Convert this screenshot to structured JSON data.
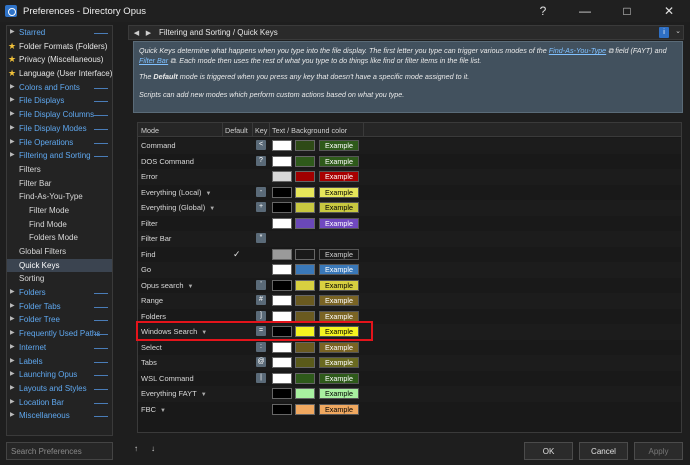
{
  "window": {
    "title": "Preferences - Directory Opus",
    "controls": [
      "?",
      "—",
      "□",
      "✕"
    ]
  },
  "sidebar": {
    "items": [
      {
        "label": "Starred",
        "level": "top"
      },
      {
        "label": "Folder Formats (Folders)",
        "level": "star"
      },
      {
        "label": "Privacy (Miscellaneous)",
        "level": "star"
      },
      {
        "label": "Language (User Interface)",
        "level": "star"
      },
      {
        "label": "Colors and Fonts",
        "level": "top"
      },
      {
        "label": "File Displays",
        "level": "top"
      },
      {
        "label": "File Display Columns",
        "level": "top"
      },
      {
        "label": "File Display Modes",
        "level": "top"
      },
      {
        "label": "File Operations",
        "level": "top"
      },
      {
        "label": "Filtering and Sorting",
        "level": "top"
      },
      {
        "label": "Filters",
        "level": "sub"
      },
      {
        "label": "Filter Bar",
        "level": "sub"
      },
      {
        "label": "Find-As-You-Type",
        "level": "sub"
      },
      {
        "label": "Filter Mode",
        "level": "subsub"
      },
      {
        "label": "Find Mode",
        "level": "subsub"
      },
      {
        "label": "Folders Mode",
        "level": "subsub"
      },
      {
        "label": "Global Filters",
        "level": "sub"
      },
      {
        "label": "Quick Keys",
        "level": "sub",
        "selected": true
      },
      {
        "label": "Sorting",
        "level": "sub"
      },
      {
        "label": "Folders",
        "level": "top"
      },
      {
        "label": "Folder Tabs",
        "level": "top"
      },
      {
        "label": "Folder Tree",
        "level": "top"
      },
      {
        "label": "Frequently Used Paths",
        "level": "top"
      },
      {
        "label": "Internet",
        "level": "top"
      },
      {
        "label": "Labels",
        "level": "top"
      },
      {
        "label": "Launching Opus",
        "level": "top"
      },
      {
        "label": "Layouts and Styles",
        "level": "top"
      },
      {
        "label": "Location Bar",
        "level": "top"
      },
      {
        "label": "Miscellaneous",
        "level": "top"
      }
    ]
  },
  "header": {
    "title": "Filtering and Sorting / Quick Keys",
    "info": "i"
  },
  "info": {
    "p1_a": "Quick Keys determine what happens when you type into the file display. The first letter you type can trigger various modes of the ",
    "link1": "Find-As-You-Type",
    "p1_b": " field (FAYT) and ",
    "link2": "Filter Bar",
    "p1_c": ". Each mode then uses the rest of what you type to do things like find or filter items in the file list.",
    "p2_a": "The ",
    "p2_bold": "Default",
    "p2_b": " mode is triggered when you press any key that doesn't have a specific mode assigned to it.",
    "p3": "Scripts can add new modes which perform custom actions based on what you type."
  },
  "grid": {
    "columns": [
      "Mode",
      "Default",
      "Key",
      "Text / Background color"
    ],
    "rows": [
      {
        "mode": "Command",
        "dropdown": false,
        "default": "",
        "key": "<",
        "sw1": "#ffffff",
        "sw2": "#2e4a16",
        "ex_fg": "#ffffff",
        "ex_bg": "#2e5a1a",
        "example": "Example"
      },
      {
        "mode": "DOS Command",
        "dropdown": false,
        "default": "",
        "key": "?",
        "sw1": "#ffffff",
        "sw2": "#2e5a1a",
        "ex_fg": "#ffffff",
        "ex_bg": "#2e5a1a",
        "example": "Example"
      },
      {
        "mode": "Error",
        "dropdown": false,
        "default": "",
        "key": "",
        "sw1": "#d8d8d8",
        "sw2": "#a00000",
        "ex_fg": "#ffffff",
        "ex_bg": "#a80000",
        "example": "Example"
      },
      {
        "mode": "Everything (Local)",
        "dropdown": true,
        "default": "",
        "key": "-",
        "sw1": "#000000",
        "sw2": "#e6e65a",
        "ex_fg": "#000000",
        "ex_bg": "#e6e65a",
        "example": "Example"
      },
      {
        "mode": "Everything (Global)",
        "dropdown": true,
        "default": "",
        "key": "+",
        "sw1": "#000000",
        "sw2": "#c8c840",
        "ex_fg": "#000000",
        "ex_bg": "#c8c840",
        "example": "Example"
      },
      {
        "mode": "Filter",
        "dropdown": false,
        "default": "",
        "key": "",
        "sw1": "#ffffff",
        "sw2": "#6a48b8",
        "ex_fg": "#ffffff",
        "ex_bg": "#7048c0",
        "example": "Example"
      },
      {
        "mode": "Filter Bar",
        "dropdown": false,
        "default": "",
        "key": "*",
        "sw1": "",
        "sw2": "",
        "ex_fg": "",
        "ex_bg": "",
        "example": ""
      },
      {
        "mode": "Find",
        "dropdown": false,
        "default": "✓",
        "key": "",
        "sw1": "#9a9a9a",
        "sw2": "#1a1a1a",
        "ex_fg": "#cfcfcf",
        "ex_bg": "#1a1a1a",
        "example": "Example"
      },
      {
        "mode": "Go",
        "dropdown": false,
        "default": "",
        "key": "",
        "sw1": "#ffffff",
        "sw2": "#3a78b8",
        "ex_fg": "#ffffff",
        "ex_bg": "#3a78b8",
        "example": "Example"
      },
      {
        "mode": "Opus search",
        "dropdown": true,
        "default": "",
        "key": "'",
        "sw1": "#000000",
        "sw2": "#d8d040",
        "ex_fg": "#000000",
        "ex_bg": "#d8d040",
        "example": "Example"
      },
      {
        "mode": "Range",
        "dropdown": false,
        "default": "",
        "key": "#",
        "sw1": "#ffffff",
        "sw2": "#6a5a20",
        "ex_fg": "#ffffff",
        "ex_bg": "#7a6424",
        "example": "Example"
      },
      {
        "mode": "Folders",
        "dropdown": false,
        "default": "",
        "key": "]",
        "sw1": "#ffffff",
        "sw2": "#6a5a20",
        "ex_fg": "#ffffff",
        "ex_bg": "#7a6424",
        "example": "Example"
      },
      {
        "mode": "Windows Search",
        "dropdown": true,
        "default": "",
        "key": "=",
        "sw1": "#000000",
        "sw2": "#f5f520",
        "ex_fg": "#000000",
        "ex_bg": "#f5f520",
        "example": "Example"
      },
      {
        "mode": "Select",
        "dropdown": false,
        "default": "",
        "key": ":",
        "sw1": "#ffffff",
        "sw2": "#6a5a20",
        "ex_fg": "#ffffff",
        "ex_bg": "#7a6424",
        "example": "Example"
      },
      {
        "mode": "Tabs",
        "dropdown": false,
        "default": "",
        "key": "@",
        "sw1": "#ffffff",
        "sw2": "#5a5a1a",
        "ex_fg": "#ffffff",
        "ex_bg": "#6a6a20",
        "example": "Example"
      },
      {
        "mode": "WSL Command",
        "dropdown": false,
        "default": "",
        "key": "|",
        "sw1": "#ffffff",
        "sw2": "#2e5a1a",
        "ex_fg": "#ffffff",
        "ex_bg": "#2e5a1a",
        "example": "Example"
      },
      {
        "mode": "Everything FAYT",
        "dropdown": true,
        "default": "",
        "key": "",
        "sw1": "#000000",
        "sw2": "#a8f0a0",
        "ex_fg": "#000000",
        "ex_bg": "#a8f0a0",
        "example": "Example"
      },
      {
        "mode": "FBC",
        "dropdown": true,
        "default": "",
        "key": "",
        "sw1": "#000000",
        "sw2": "#f0a860",
        "ex_fg": "#000000",
        "ex_bg": "#f0a860",
        "example": "Example"
      }
    ]
  },
  "footer": {
    "search_placeholder": "Search Preferences",
    "nav_up": "↑",
    "nav_down": "↓",
    "ok": "OK",
    "cancel": "Cancel",
    "apply": "Apply"
  }
}
